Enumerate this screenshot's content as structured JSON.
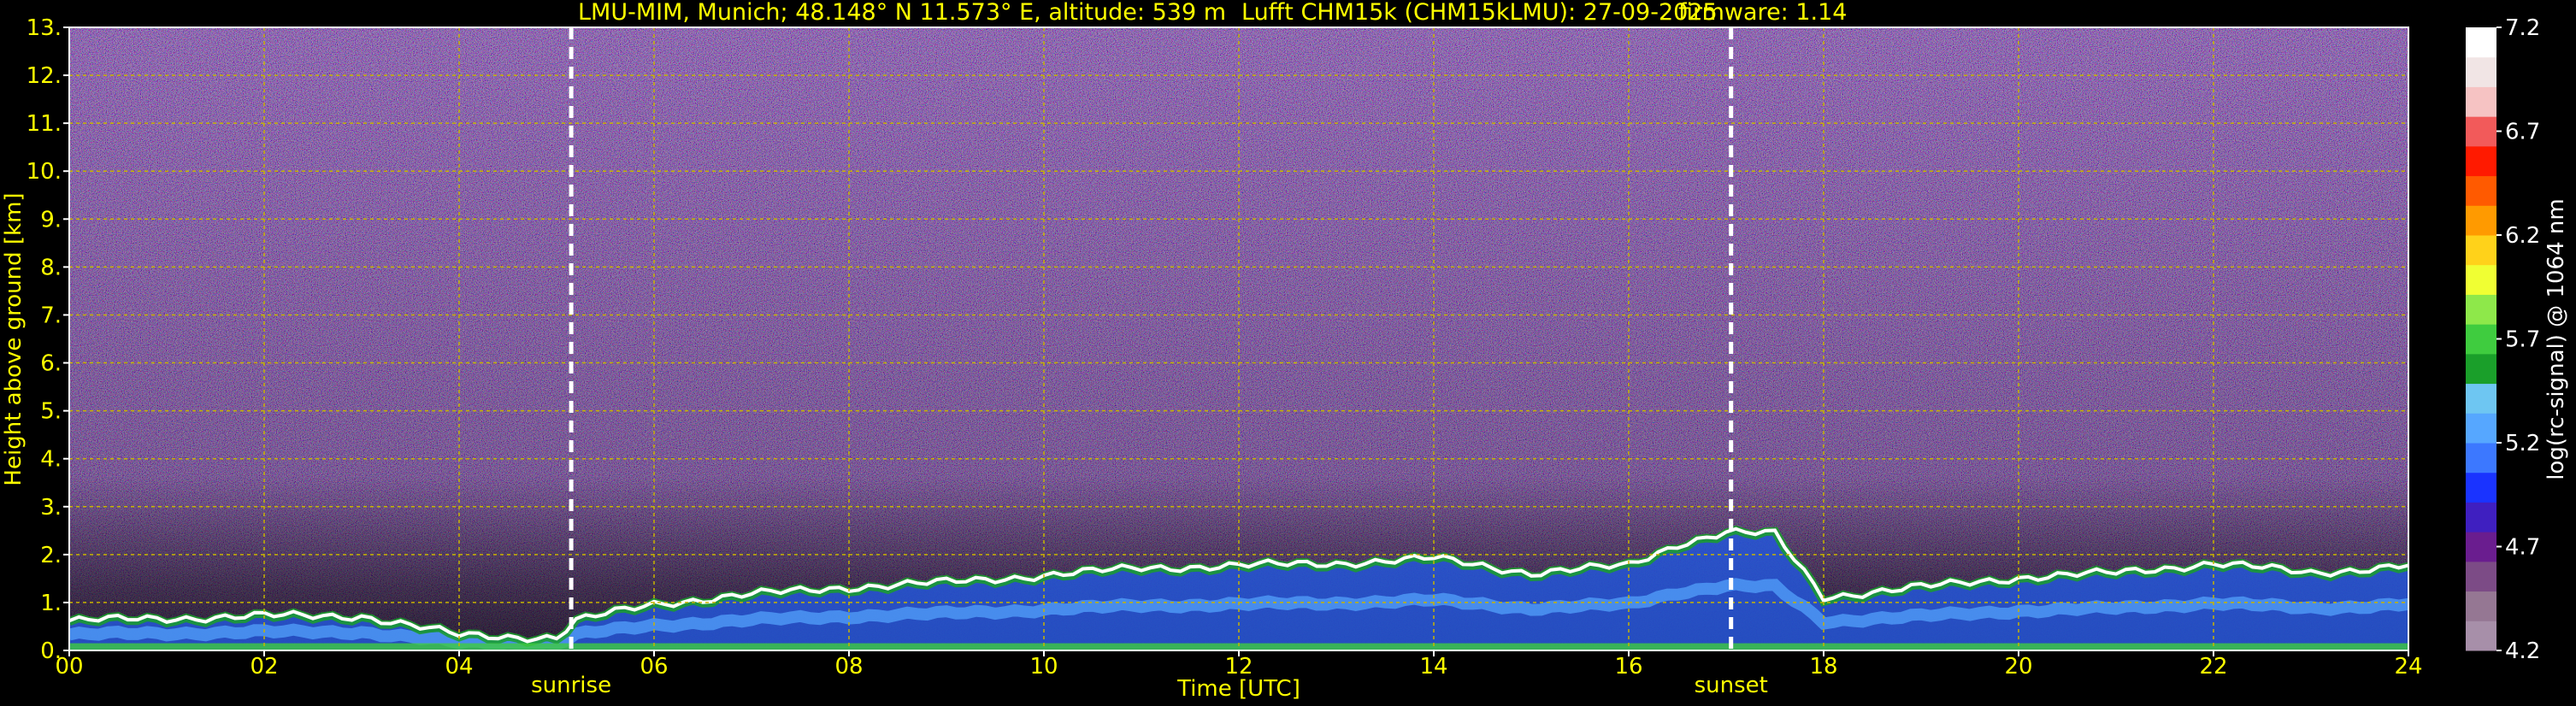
{
  "title": {
    "location": "LMU-MIM, Munich; 48.148° N 11.573° E, altitude: 539 m",
    "instrument": "Lufft CHM15k (CHM15kLMU): 27-09-2025",
    "firmware": "firmware: 1.14"
  },
  "chart_data": {
    "type": "heatmap",
    "xlabel": "Time [UTC]",
    "ylabel": "Height above ground [km]",
    "xlim": [
      0,
      24
    ],
    "ylim": [
      0,
      13
    ],
    "x_ticks": [
      "00",
      "02",
      "04",
      "06",
      "08",
      "10",
      "12",
      "14",
      "16",
      "18",
      "20",
      "22",
      "24"
    ],
    "y_ticks": [
      "0.",
      "1.",
      "2.",
      "3.",
      "4.",
      "5.",
      "6.",
      "7.",
      "8.",
      "9.",
      "10.",
      "11.",
      "12.",
      "13."
    ],
    "grid": true,
    "annotations": [
      {
        "label": "sunrise",
        "x": 5.15
      },
      {
        "label": "sunset",
        "x": 17.05
      }
    ],
    "colorbar": {
      "label": "log(rc-signal) @ 1064 nm",
      "range": [
        4.2,
        7.2
      ],
      "tick_labels": [
        "4.2",
        "4.7",
        "5.2",
        "5.7",
        "6.2",
        "6.7",
        "7.2"
      ]
    },
    "boundary_layer_top_km": {
      "x": [
        0,
        1,
        2,
        3,
        4,
        5,
        5.2,
        6,
        7,
        8,
        9,
        10,
        11,
        12,
        13,
        14,
        15,
        16,
        16.5,
        17,
        17.5,
        18,
        19,
        20,
        21,
        22,
        23,
        24
      ],
      "y": [
        0.6,
        0.65,
        0.7,
        0.7,
        0.3,
        0.25,
        0.6,
        0.95,
        1.15,
        1.3,
        1.4,
        1.55,
        1.7,
        1.75,
        1.8,
        1.9,
        1.6,
        1.75,
        2.2,
        2.45,
        2.4,
        1.1,
        1.3,
        1.5,
        1.6,
        1.8,
        1.6,
        1.75
      ]
    }
  },
  "colors": {
    "axis_text": "#ffff00",
    "grid": "#c8b400",
    "background_signal": "#3a2a4a",
    "colorbar_scale": [
      "#a78fa9",
      "#957793",
      "#7c4b86",
      "#6a1d8f",
      "#3f1fc0",
      "#1a33ff",
      "#3c78ff",
      "#56a7ff",
      "#6ec6f2",
      "#1a9f2a",
      "#3fcc3f",
      "#8ee84a",
      "#f0ff33",
      "#ffd21a",
      "#ff9a00",
      "#ff5a00",
      "#ff1a00",
      "#f25a5a",
      "#f6c3c3",
      "#f1e5e5",
      "#ffffff"
    ]
  }
}
